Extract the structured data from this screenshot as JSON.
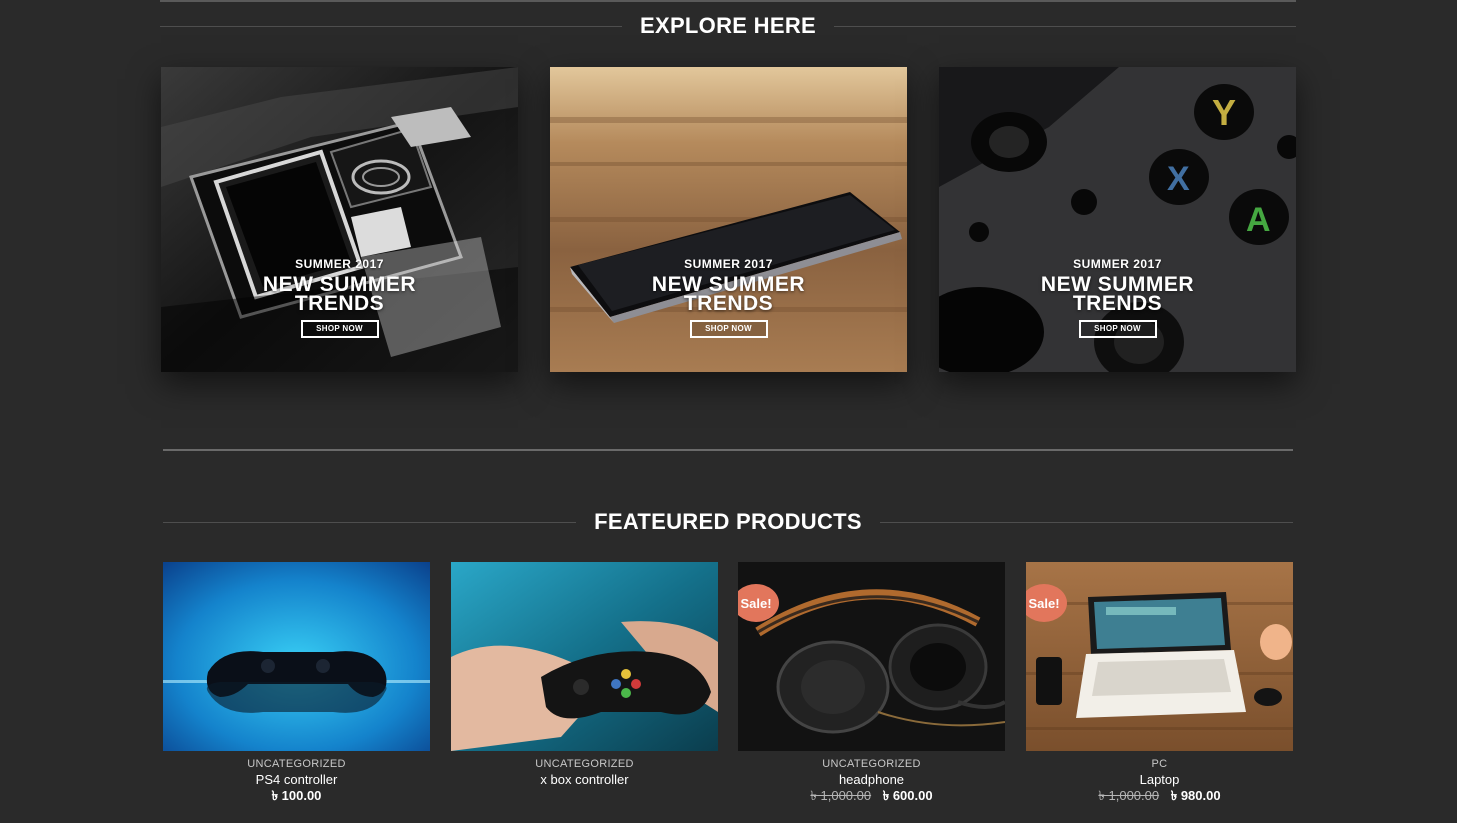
{
  "explore": {
    "heading": "EXPLORE HERE",
    "promos": [
      {
        "kicker": "SUMMER 2017",
        "headline": "NEW SUMMER TRENDS",
        "button": "SHOP NOW",
        "image": "phone-in-box-photo"
      },
      {
        "kicker": "SUMMER 2017",
        "headline": "NEW SUMMER TRENDS",
        "button": "SHOP NOW",
        "image": "phone-on-wood-photo"
      },
      {
        "kicker": "SUMMER 2017",
        "headline": "NEW SUMMER TRENDS",
        "button": "SHOP NOW",
        "image": "game-controller-closeup-photo"
      }
    ]
  },
  "featured": {
    "heading": "FEATEURED PRODUCTS",
    "products": [
      {
        "category": "UNCATEGORIZED",
        "name": "PS4 controller",
        "price": "৳ 100.00",
        "old_price": "",
        "sale_badge": "",
        "image": "ps4-controller-photo"
      },
      {
        "category": "UNCATEGORIZED",
        "name": "x box controller",
        "price": "",
        "old_price": "",
        "sale_badge": "",
        "image": "xbox-controller-in-hands-photo"
      },
      {
        "category": "UNCATEGORIZED",
        "name": "headphone",
        "price": "৳ 600.00",
        "old_price": "৳ 1,000.00",
        "sale_badge": "Sale!",
        "image": "headphones-photo"
      },
      {
        "category": "PC",
        "name": "Laptop",
        "price": "৳ 980.00",
        "old_price": "৳ 1,000.00",
        "sale_badge": "Sale!",
        "image": "laptop-on-desk-photo"
      }
    ]
  },
  "colors": {
    "page_background": "#2a2a2a",
    "sale_badge": "#e2765c",
    "text": "#ffffff"
  }
}
